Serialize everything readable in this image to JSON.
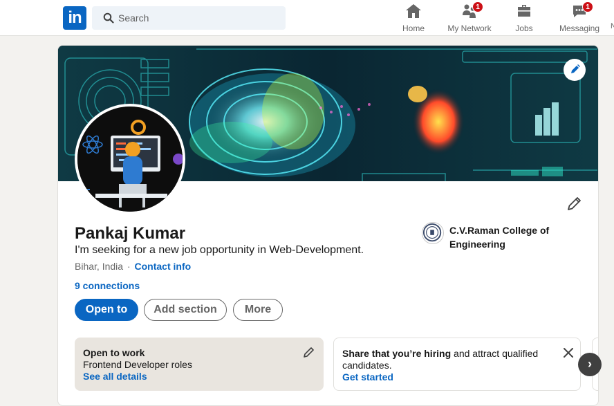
{
  "nav": {
    "logo_text": "in",
    "search_placeholder": "Search",
    "items": [
      {
        "label": "Home",
        "icon": "home-icon"
      },
      {
        "label": "My Network",
        "icon": "network-icon",
        "badge": "1"
      },
      {
        "label": "Jobs",
        "icon": "jobs-icon"
      },
      {
        "label": "Messaging",
        "icon": "messaging-icon",
        "badge": "1"
      }
    ],
    "overflow_label": "N"
  },
  "profile": {
    "name": "Pankaj Kumar",
    "headline": "I'm seeking for a new job opportunity in Web-Development.",
    "location": "Bihar, India",
    "separator": "·",
    "contact_label": "Contact info",
    "connections": "9 connections",
    "college": "C.V.Raman College of Engineering"
  },
  "actions": {
    "open_to": "Open to",
    "add_section": "Add section",
    "more": "More"
  },
  "tiles": {
    "open_to_work": {
      "title": "Open to work",
      "subtitle": "Frontend Developer roles",
      "link": "See all details"
    },
    "hiring": {
      "bold": "Share that you’re hiring",
      "rest": " and attract qualified candidates.",
      "link": "Get started"
    }
  },
  "colors": {
    "brand": "#0a66c2",
    "badge": "#cc1016",
    "page_bg": "#f3f2ef",
    "otw_bg": "#e9e5df"
  }
}
